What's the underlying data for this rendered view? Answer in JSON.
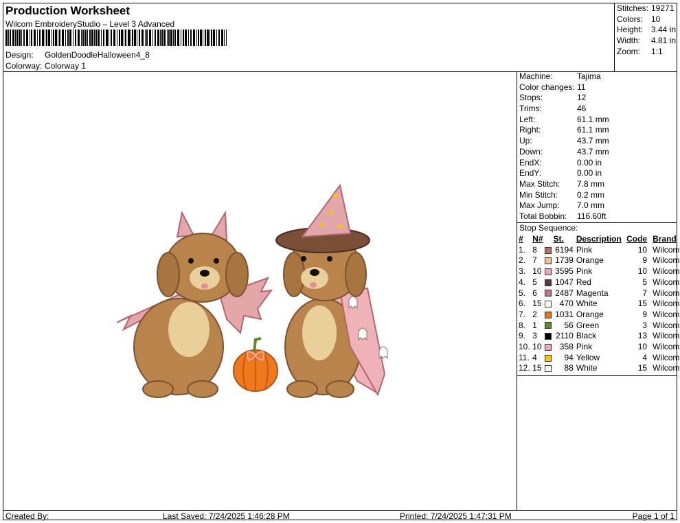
{
  "header": {
    "title": "Production Worksheet",
    "subtitle": "Wilcom EmbroideryStudio – Level 3 Advanced",
    "design_label": "Design:",
    "design_value": "GoldenDoodleHalloween4_8",
    "colorway_label": "Colorway:",
    "colorway_value": "Colorway 1"
  },
  "stats": [
    {
      "label": "Stitches:",
      "value": "19271"
    },
    {
      "label": "Colors:",
      "value": "10"
    },
    {
      "label": "Height:",
      "value": "3.44 in"
    },
    {
      "label": "Width:",
      "value": "4.81 in"
    },
    {
      "label": "Zoom:",
      "value": "1:1"
    }
  ],
  "machine_info": [
    {
      "label": "Machine:",
      "value": "Tajima"
    },
    {
      "label": "Color changes:",
      "value": "11"
    },
    {
      "label": "Stops:",
      "value": "12"
    },
    {
      "label": "Trims:",
      "value": "46"
    },
    {
      "label": "Left:",
      "value": "61.1 mm"
    },
    {
      "label": "Right:",
      "value": "61.1 mm"
    },
    {
      "label": "Up:",
      "value": "43.7 mm"
    },
    {
      "label": "Down:",
      "value": "43.7 mm"
    },
    {
      "label": "EndX:",
      "value": "0.00 in"
    },
    {
      "label": "EndY:",
      "value": "0.00 in"
    },
    {
      "label": "Max Stitch:",
      "value": "7.8 mm"
    },
    {
      "label": "Min Stitch:",
      "value": "0.2 mm"
    },
    {
      "label": "Max Jump:",
      "value": "7.0 mm"
    },
    {
      "label": "Total Bobbin:",
      "value": "116.60ft"
    }
  ],
  "stop_sequence": {
    "title": "Stop Sequence:",
    "headers": {
      "idx": "#",
      "n": "N#",
      "st": "St.",
      "desc": "Description",
      "code": "Code",
      "brand": "Brand"
    },
    "rows": [
      {
        "idx": "1.",
        "n": "8",
        "color": "#b8705a",
        "st": "6194",
        "desc": "Pink",
        "code": "10",
        "brand": "Wilcom"
      },
      {
        "idx": "2.",
        "n": "7",
        "color": "#e8c48a",
        "st": "1739",
        "desc": "Orange",
        "code": "9",
        "brand": "Wilcom"
      },
      {
        "idx": "3.",
        "n": "10",
        "color": "#f2a6b4",
        "st": "3595",
        "desc": "Pink",
        "code": "10",
        "brand": "Wilcom"
      },
      {
        "idx": "4.",
        "n": "5",
        "color": "#5a3a34",
        "st": "1047",
        "desc": "Red",
        "code": "5",
        "brand": "Wilcom"
      },
      {
        "idx": "5.",
        "n": "6",
        "color": "#c8708c",
        "st": "2487",
        "desc": "Magenta",
        "code": "7",
        "brand": "Wilcom"
      },
      {
        "idx": "6.",
        "n": "15",
        "color": "#ffffff",
        "st": "470",
        "desc": "White",
        "code": "15",
        "brand": "Wilcom"
      },
      {
        "idx": "7.",
        "n": "2",
        "color": "#f07010",
        "st": "1031",
        "desc": "Orange",
        "code": "9",
        "brand": "Wilcom"
      },
      {
        "idx": "8.",
        "n": "1",
        "color": "#5a8a2a",
        "st": "56",
        "desc": "Green",
        "code": "3",
        "brand": "Wilcom"
      },
      {
        "idx": "9.",
        "n": "3",
        "color": "#000000",
        "st": "2110",
        "desc": "Black",
        "code": "13",
        "brand": "Wilcom"
      },
      {
        "idx": "10.",
        "n": "10",
        "color": "#f2a6b4",
        "st": "358",
        "desc": "Pink",
        "code": "10",
        "brand": "Wilcom"
      },
      {
        "idx": "11.",
        "n": "4",
        "color": "#f5c800",
        "st": "94",
        "desc": "Yellow",
        "code": "4",
        "brand": "Wilcom"
      },
      {
        "idx": "12.",
        "n": "15",
        "color": "#ffffff",
        "st": "88",
        "desc": "White",
        "code": "15",
        "brand": "Wilcom"
      }
    ]
  },
  "footer": {
    "created_by": "Created By:",
    "last_saved": "Last Saved: 7/24/2025 1:46:28 PM",
    "printed": "Printed: 7/24/2025 1:47:31 PM",
    "page": "Page 1 of 1"
  }
}
